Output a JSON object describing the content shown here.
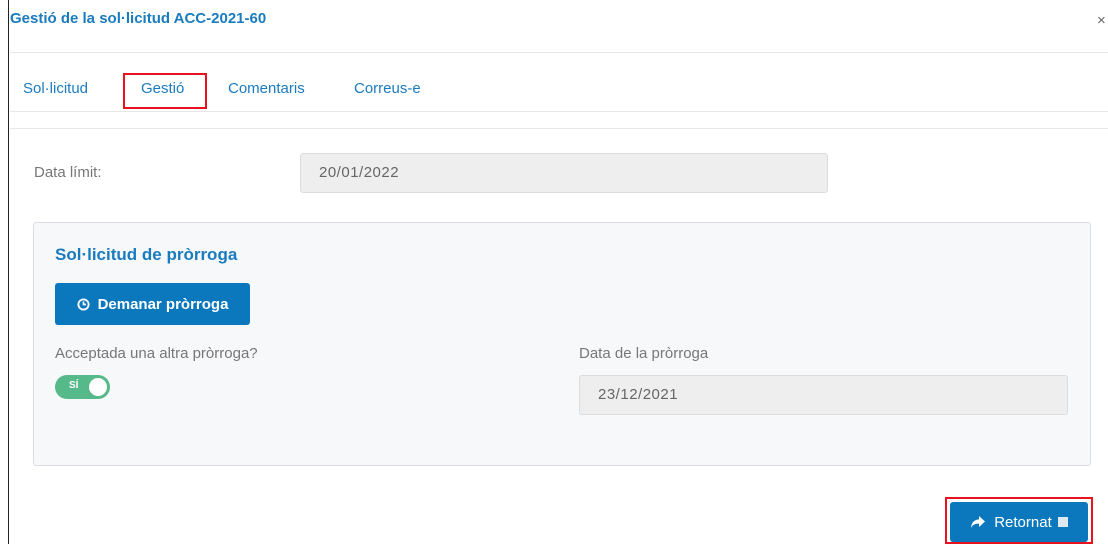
{
  "dialog": {
    "title": "Gestió de la sol·licitud ACC-2021-60",
    "close_glyph": "×"
  },
  "tabs": [
    {
      "label": "Sol·licitud",
      "active": false
    },
    {
      "label": "Gestió",
      "active": true
    },
    {
      "label": "Comentaris",
      "active": false
    },
    {
      "label": "Correus-e",
      "active": false
    }
  ],
  "form": {
    "deadline_label": "Data límit:",
    "deadline_value": "20/01/2022"
  },
  "extension": {
    "title": "Sol·licitud de pròrroga",
    "request_button": "Demanar pròrroga",
    "request_button_icon": "clock-icon",
    "accepted_label": "Acceptada una altra pròrroga?",
    "toggle_text": "SÍ",
    "toggle_on": true,
    "date_label": "Data de la pròrroga",
    "date_value": "23/12/2021"
  },
  "footer": {
    "return_button": "Retornat",
    "return_icon": "share-arrow-icon"
  },
  "colors": {
    "link_blue": "#1a7bbf",
    "button_blue": "#0b78bd",
    "toggle_green": "#56b98a",
    "highlight_red": "#e8131e"
  }
}
